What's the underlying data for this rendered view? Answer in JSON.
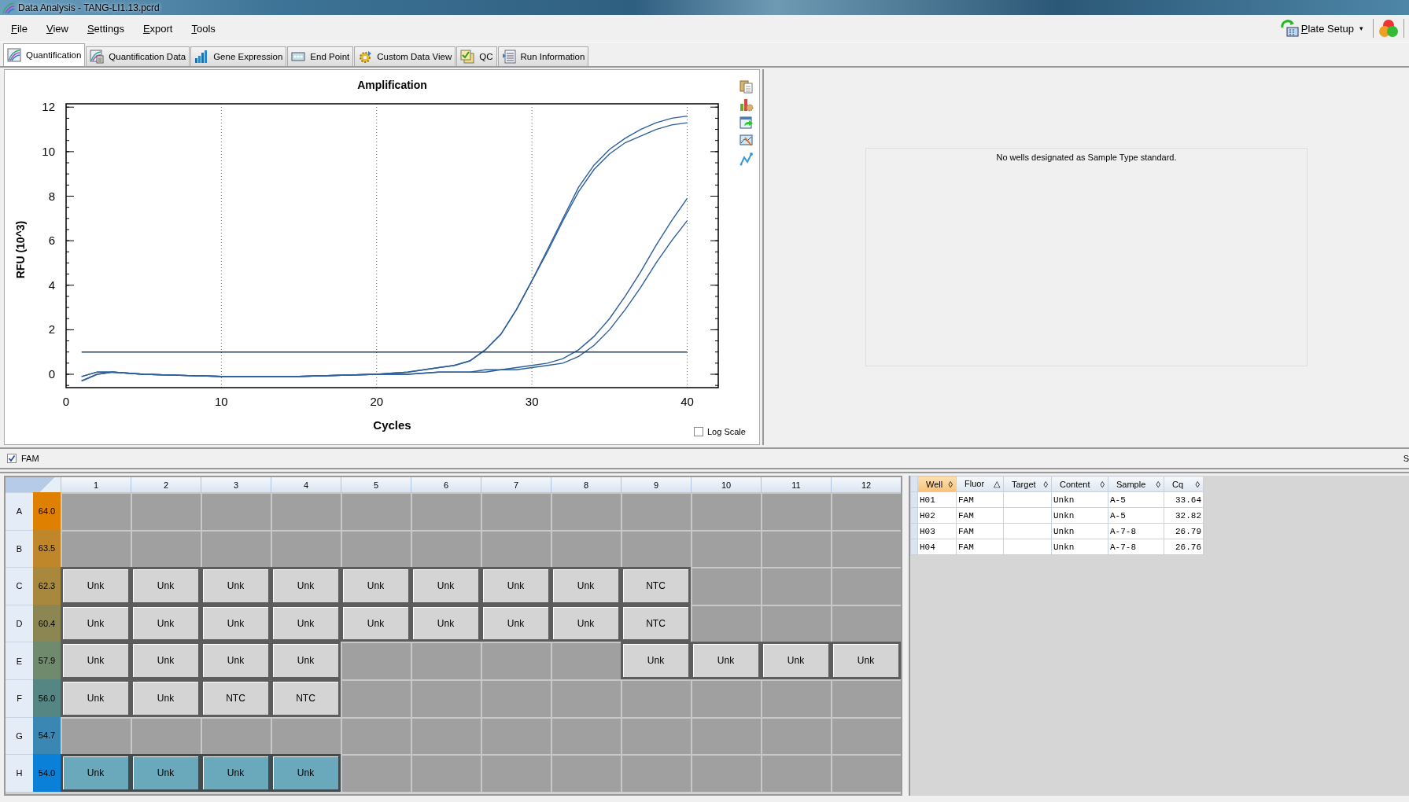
{
  "window": {
    "title": "Data Analysis - TANG-LI1.13.pcrd"
  },
  "menu": [
    "File",
    "View",
    "Settings",
    "Export",
    "Tools"
  ],
  "plate_setup": {
    "label": "Plate Setup",
    "caret": "▾"
  },
  "tabs": [
    {
      "label": "Quantification",
      "selected": true
    },
    {
      "label": "Quantification Data",
      "selected": false
    },
    {
      "label": "Gene Expression",
      "selected": false
    },
    {
      "label": "End Point",
      "selected": false
    },
    {
      "label": "Custom Data View",
      "selected": false
    },
    {
      "label": "QC",
      "selected": false
    },
    {
      "label": "Run Information",
      "selected": false
    }
  ],
  "chart": {
    "log_scale": {
      "label": "Log Scale",
      "checked": false
    },
    "chart_data": {
      "type": "line",
      "title": "Amplification",
      "xlabel": "Cycles",
      "ylabel": "RFU (10^3)",
      "x": [
        1,
        2,
        3,
        5,
        10,
        15,
        20,
        22,
        24,
        25,
        26,
        27,
        28,
        29,
        30,
        31,
        32,
        33,
        34,
        35,
        36,
        37,
        38,
        39,
        40
      ],
      "series": [
        {
          "color": "#2d5f9e",
          "values": [
            -0.1,
            0.1,
            0.1,
            0.0,
            -0.1,
            -0.1,
            0.0,
            0.1,
            0.3,
            0.4,
            0.6,
            1.1,
            1.8,
            2.9,
            4.2,
            5.6,
            7.0,
            8.4,
            9.4,
            10.1,
            10.6,
            11.0,
            11.3,
            11.5,
            11.6
          ]
        },
        {
          "color": "#2d5f9e",
          "values": [
            -0.3,
            0.0,
            0.1,
            0.0,
            -0.1,
            -0.1,
            0.0,
            0.1,
            0.3,
            0.4,
            0.6,
            1.1,
            1.8,
            2.9,
            4.2,
            5.5,
            6.9,
            8.2,
            9.2,
            9.9,
            10.4,
            10.7,
            11.0,
            11.2,
            11.3
          ]
        },
        {
          "color": "#2d5f9e",
          "values": [
            -0.1,
            0.1,
            0.1,
            0.0,
            -0.1,
            -0.1,
            0.0,
            0.0,
            0.1,
            0.1,
            0.1,
            0.2,
            0.2,
            0.3,
            0.4,
            0.5,
            0.7,
            1.1,
            1.7,
            2.5,
            3.5,
            4.6,
            5.8,
            6.9,
            7.9
          ]
        },
        {
          "color": "#2d5f9e",
          "values": [
            -0.3,
            0.0,
            0.1,
            0.0,
            -0.1,
            -0.1,
            0.0,
            0.0,
            0.1,
            0.1,
            0.1,
            0.1,
            0.2,
            0.2,
            0.3,
            0.4,
            0.5,
            0.8,
            1.3,
            2.0,
            2.9,
            3.9,
            5.0,
            6.0,
            6.9
          ]
        },
        {
          "color": "#1b3d6b",
          "values": [
            1.0,
            1.0,
            1.0,
            1.0,
            1.0,
            1.0,
            1.0,
            1.0,
            1.0,
            1.0,
            1.0,
            1.0,
            1.0,
            1.0,
            1.0,
            1.0,
            1.0,
            1.0,
            1.0,
            1.0,
            1.0,
            1.0,
            1.0,
            1.0,
            1.0
          ]
        }
      ],
      "grid": true,
      "xlim": [
        0,
        42
      ],
      "ylim": [
        -0.6,
        12.15
      ],
      "xticks": [
        0,
        10,
        20,
        30,
        40
      ],
      "yticks": [
        0,
        2,
        4,
        6,
        8,
        10,
        12
      ]
    }
  },
  "standard_curve": {
    "message": "No wells designated as Sample Type standard."
  },
  "fluor_filter": {
    "label": "FAM",
    "checked": true,
    "side_label": "S"
  },
  "plate": {
    "columns": [
      "1",
      "2",
      "3",
      "4",
      "5",
      "6",
      "7",
      "8",
      "9",
      "10",
      "11",
      "12"
    ],
    "rows": [
      {
        "label": "A",
        "temp": "64.0",
        "color": "#e08000",
        "wells": [
          {
            "kind": "empty",
            "selected": false
          },
          {
            "kind": "empty",
            "selected": false
          },
          {
            "kind": "empty",
            "selected": false
          },
          {
            "kind": "empty",
            "selected": false
          },
          {
            "kind": "empty",
            "selected": false
          },
          {
            "kind": "empty",
            "selected": false
          },
          {
            "kind": "empty",
            "selected": false
          },
          {
            "kind": "empty",
            "selected": false
          },
          {
            "kind": "empty",
            "selected": false
          },
          {
            "kind": "empty",
            "selected": false
          },
          {
            "kind": "empty",
            "selected": false
          },
          {
            "kind": "empty",
            "selected": false
          }
        ]
      },
      {
        "label": "B",
        "temp": "63.5",
        "color": "#c0862a",
        "wells": [
          {
            "kind": "empty",
            "selected": false
          },
          {
            "kind": "empty",
            "selected": false
          },
          {
            "kind": "empty",
            "selected": false
          },
          {
            "kind": "empty",
            "selected": false
          },
          {
            "kind": "empty",
            "selected": false
          },
          {
            "kind": "empty",
            "selected": false
          },
          {
            "kind": "empty",
            "selected": false
          },
          {
            "kind": "empty",
            "selected": false
          },
          {
            "kind": "empty",
            "selected": false
          },
          {
            "kind": "empty",
            "selected": false
          },
          {
            "kind": "empty",
            "selected": false
          },
          {
            "kind": "empty",
            "selected": false
          }
        ]
      },
      {
        "label": "C",
        "temp": "62.3",
        "color": "#a8883c",
        "wells": [
          {
            "kind": "sample",
            "content": "Unk",
            "selected": false
          },
          {
            "kind": "sample",
            "content": "Unk",
            "selected": false
          },
          {
            "kind": "sample",
            "content": "Unk",
            "selected": false
          },
          {
            "kind": "sample",
            "content": "Unk",
            "selected": false
          },
          {
            "kind": "sample",
            "content": "Unk",
            "selected": false
          },
          {
            "kind": "sample",
            "content": "Unk",
            "selected": false
          },
          {
            "kind": "sample",
            "content": "Unk",
            "selected": false
          },
          {
            "kind": "sample",
            "content": "Unk",
            "selected": false
          },
          {
            "kind": "sample",
            "content": "NTC",
            "selected": false
          },
          {
            "kind": "empty",
            "selected": false
          },
          {
            "kind": "empty",
            "selected": false
          },
          {
            "kind": "empty",
            "selected": false
          }
        ]
      },
      {
        "label": "D",
        "temp": "60.4",
        "color": "#8c8752",
        "wells": [
          {
            "kind": "sample",
            "content": "Unk",
            "selected": false
          },
          {
            "kind": "sample",
            "content": "Unk",
            "selected": false
          },
          {
            "kind": "sample",
            "content": "Unk",
            "selected": false
          },
          {
            "kind": "sample",
            "content": "Unk",
            "selected": false
          },
          {
            "kind": "sample",
            "content": "Unk",
            "selected": false
          },
          {
            "kind": "sample",
            "content": "Unk",
            "selected": false
          },
          {
            "kind": "sample",
            "content": "Unk",
            "selected": false
          },
          {
            "kind": "sample",
            "content": "Unk",
            "selected": false
          },
          {
            "kind": "sample",
            "content": "NTC",
            "selected": false
          },
          {
            "kind": "empty",
            "selected": false
          },
          {
            "kind": "empty",
            "selected": false
          },
          {
            "kind": "empty",
            "selected": false
          }
        ]
      },
      {
        "label": "E",
        "temp": "57.9",
        "color": "#6f8a6c",
        "wells": [
          {
            "kind": "sample",
            "content": "Unk",
            "selected": false
          },
          {
            "kind": "sample",
            "content": "Unk",
            "selected": false
          },
          {
            "kind": "sample",
            "content": "Unk",
            "selected": false
          },
          {
            "kind": "sample",
            "content": "Unk",
            "selected": false
          },
          {
            "kind": "empty",
            "selected": false
          },
          {
            "kind": "empty",
            "selected": false
          },
          {
            "kind": "empty",
            "selected": false
          },
          {
            "kind": "empty",
            "selected": false
          },
          {
            "kind": "sample",
            "content": "Unk",
            "selected": false
          },
          {
            "kind": "sample",
            "content": "Unk",
            "selected": false
          },
          {
            "kind": "sample",
            "content": "Unk",
            "selected": false
          },
          {
            "kind": "sample",
            "content": "Unk",
            "selected": false
          }
        ]
      },
      {
        "label": "F",
        "temp": "56.0",
        "color": "#568683",
        "wells": [
          {
            "kind": "sample",
            "content": "Unk",
            "selected": false
          },
          {
            "kind": "sample",
            "content": "Unk",
            "selected": false
          },
          {
            "kind": "sample",
            "content": "NTC",
            "selected": false
          },
          {
            "kind": "sample",
            "content": "NTC",
            "selected": false
          },
          {
            "kind": "empty",
            "selected": false
          },
          {
            "kind": "empty",
            "selected": false
          },
          {
            "kind": "empty",
            "selected": false
          },
          {
            "kind": "empty",
            "selected": false
          },
          {
            "kind": "empty",
            "selected": false
          },
          {
            "kind": "empty",
            "selected": false
          },
          {
            "kind": "empty",
            "selected": false
          },
          {
            "kind": "empty",
            "selected": false
          }
        ]
      },
      {
        "label": "G",
        "temp": "54.7",
        "color": "#3a87b4",
        "wells": [
          {
            "kind": "empty",
            "selected": false
          },
          {
            "kind": "empty",
            "selected": false
          },
          {
            "kind": "empty",
            "selected": false
          },
          {
            "kind": "empty",
            "selected": false
          },
          {
            "kind": "empty",
            "selected": false
          },
          {
            "kind": "empty",
            "selected": false
          },
          {
            "kind": "empty",
            "selected": false
          },
          {
            "kind": "empty",
            "selected": false
          },
          {
            "kind": "empty",
            "selected": false
          },
          {
            "kind": "empty",
            "selected": false
          },
          {
            "kind": "empty",
            "selected": false
          },
          {
            "kind": "empty",
            "selected": false
          }
        ]
      },
      {
        "label": "H",
        "temp": "54.0",
        "color": "#0a80d8",
        "wells": [
          {
            "kind": "sample",
            "content": "Unk",
            "selected": true
          },
          {
            "kind": "sample",
            "content": "Unk",
            "selected": true
          },
          {
            "kind": "sample",
            "content": "Unk",
            "selected": true
          },
          {
            "kind": "sample",
            "content": "Unk",
            "selected": true
          },
          {
            "kind": "empty",
            "selected": false
          },
          {
            "kind": "empty",
            "selected": false
          },
          {
            "kind": "empty",
            "selected": false
          },
          {
            "kind": "empty",
            "selected": false
          },
          {
            "kind": "empty",
            "selected": false
          },
          {
            "kind": "empty",
            "selected": false
          },
          {
            "kind": "empty",
            "selected": false
          },
          {
            "kind": "empty",
            "selected": false
          }
        ]
      }
    ]
  },
  "table": {
    "columns": [
      {
        "label": "Well",
        "sort": "◊",
        "selected": true
      },
      {
        "label": "Fluor",
        "sort": "△",
        "selected": false
      },
      {
        "label": "Target",
        "sort": "◊",
        "selected": false
      },
      {
        "label": "Content",
        "sort": "◊",
        "selected": false
      },
      {
        "label": "Sample",
        "sort": "◊",
        "selected": false
      },
      {
        "label": "Cq",
        "sort": "◊",
        "selected": false
      }
    ],
    "rows": [
      {
        "well": "H01",
        "fluor": "FAM",
        "content": "Unkn",
        "sample": "A-5",
        "cq": "33.64"
      },
      {
        "well": "H02",
        "fluor": "FAM",
        "content": "Unkn",
        "sample": "A-5",
        "cq": "32.82"
      },
      {
        "well": "H03",
        "fluor": "FAM",
        "content": "Unkn",
        "sample": "A-7-8",
        "cq": "26.79"
      },
      {
        "well": "H04",
        "fluor": "FAM",
        "content": "Unkn",
        "sample": "A-7-8",
        "cq": "26.76"
      }
    ]
  }
}
